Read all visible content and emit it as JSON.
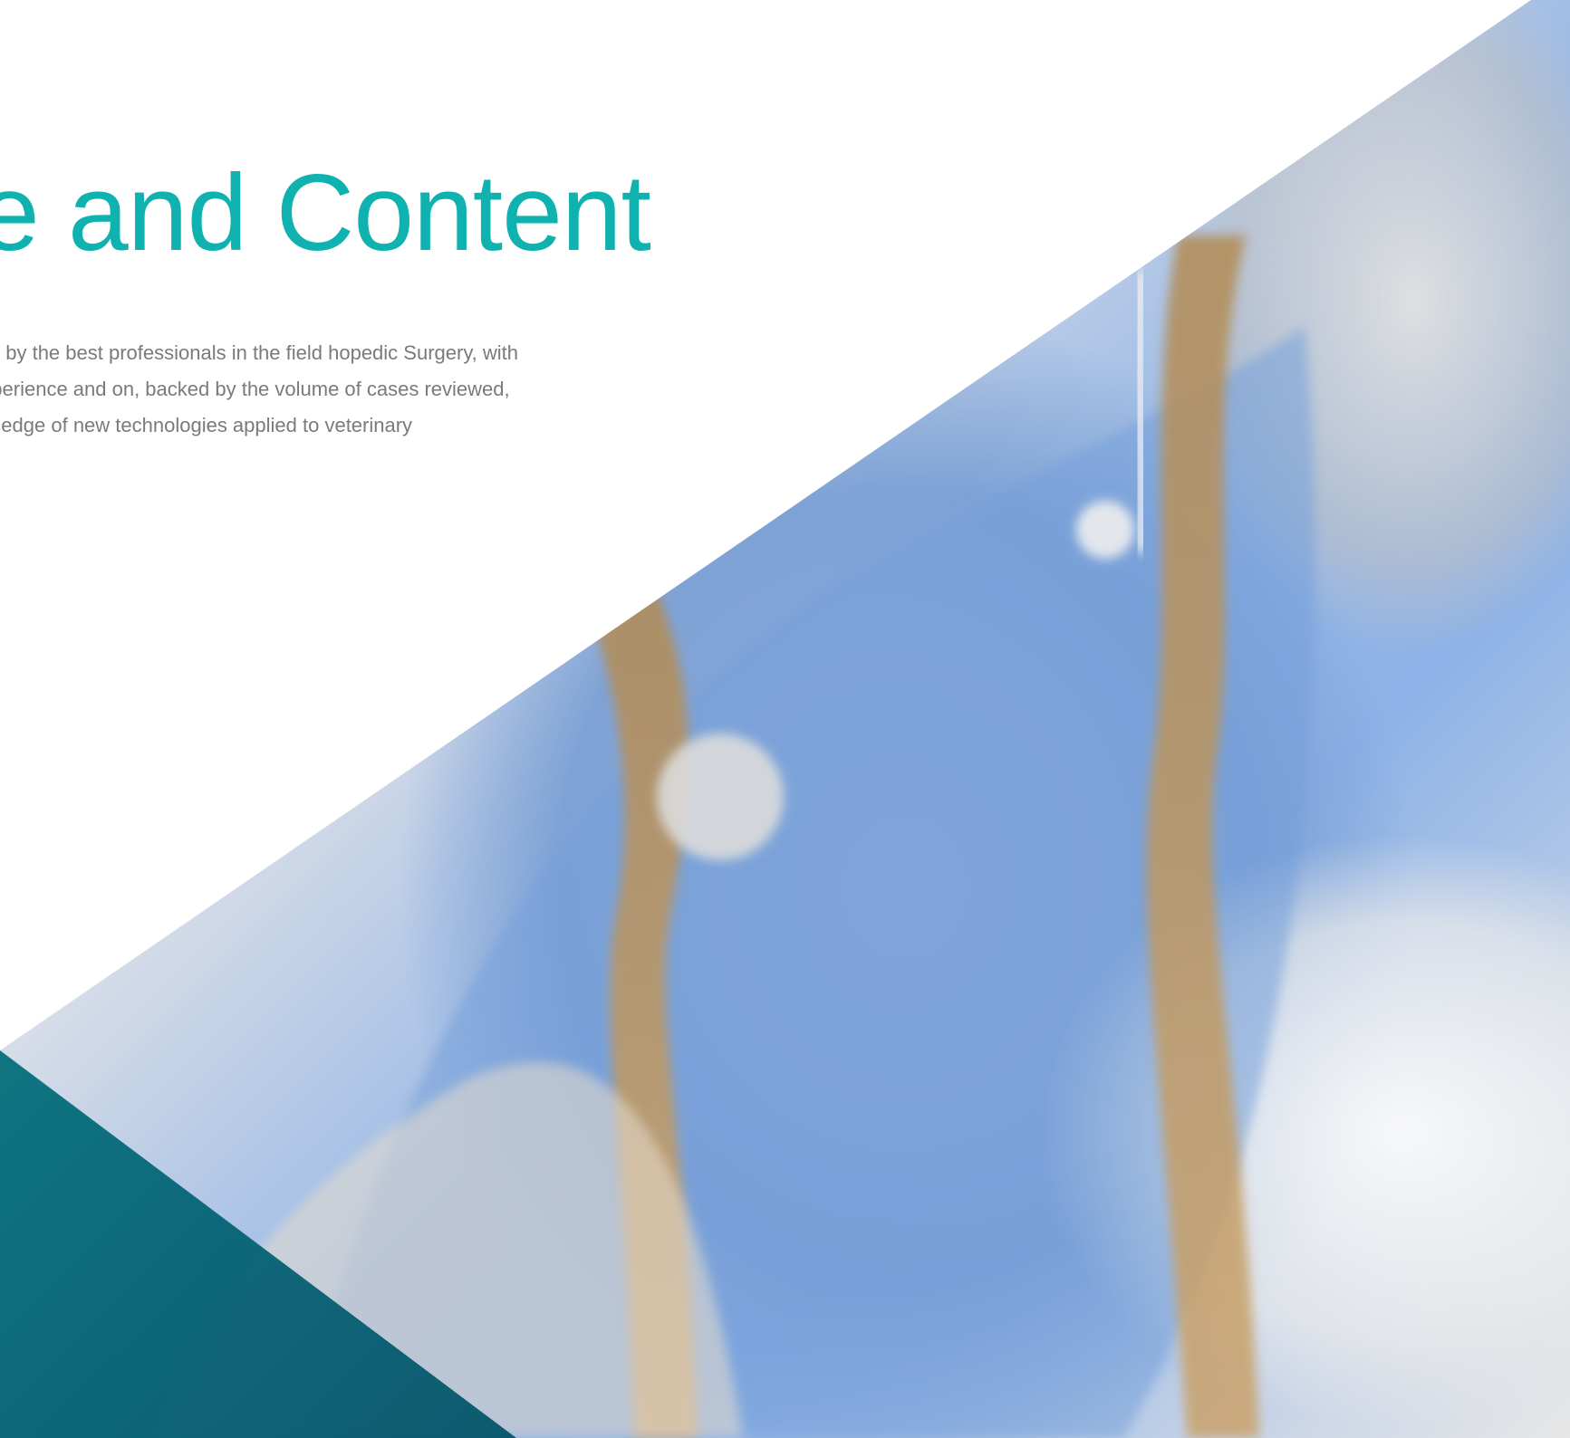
{
  "hero": {
    "title": "re and Content",
    "paragraph": "een designed by the best professionals in the field hopedic Surgery, with extensive experience and on, backed by the volume of cases reviewed, studied knowledge of new technologies applied to veterinary"
  },
  "image": {
    "alt": "veterinarian-with-dog-photo"
  },
  "colors": {
    "title": "#10b2b0",
    "body_text": "#7a7a7a",
    "teal_overlay": "#0a6e7a"
  }
}
